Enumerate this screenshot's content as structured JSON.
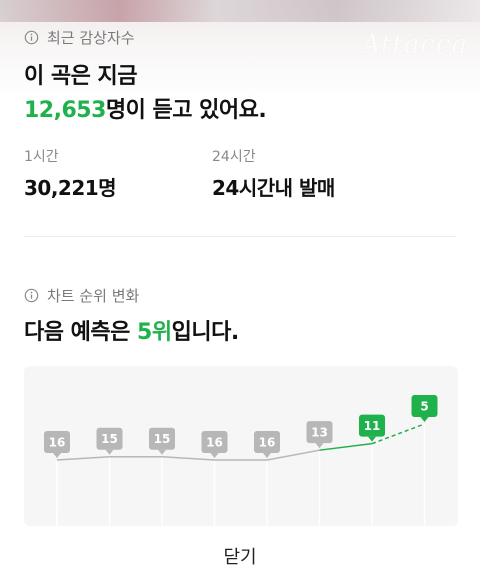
{
  "watermark": "Attacca",
  "listeners": {
    "header": "최근 감상자수",
    "headline_line1": "이 곡은 지금",
    "current_count": "12,653",
    "headline_suffix": "명이 듣고 있어요.",
    "stats": [
      {
        "label": "1시간",
        "value": "30,221명"
      },
      {
        "label": "24시간",
        "value": "24시간내 발매"
      }
    ]
  },
  "chart": {
    "header": "차트 순위 변화",
    "prediction_prefix": "다음 예측은 ",
    "prediction_rank": "5위",
    "prediction_suffix": "입니다."
  },
  "chart_data": {
    "type": "line",
    "x": [
      1,
      2,
      3,
      4,
      5,
      6,
      7,
      8
    ],
    "values": [
      16,
      15,
      15,
      16,
      16,
      13,
      11,
      5
    ],
    "labels": [
      "16",
      "15",
      "15",
      "16",
      "16",
      "13",
      "11",
      "5"
    ],
    "highlight_from_index": 6,
    "predicted_index": 7,
    "colors": {
      "past": "#b7b7b7",
      "recent": "#1fb14b",
      "grid": "#ffffff"
    }
  },
  "close_label": "닫기",
  "colors": {
    "accent": "#1fb14b",
    "muted": "#8a8a8a"
  }
}
